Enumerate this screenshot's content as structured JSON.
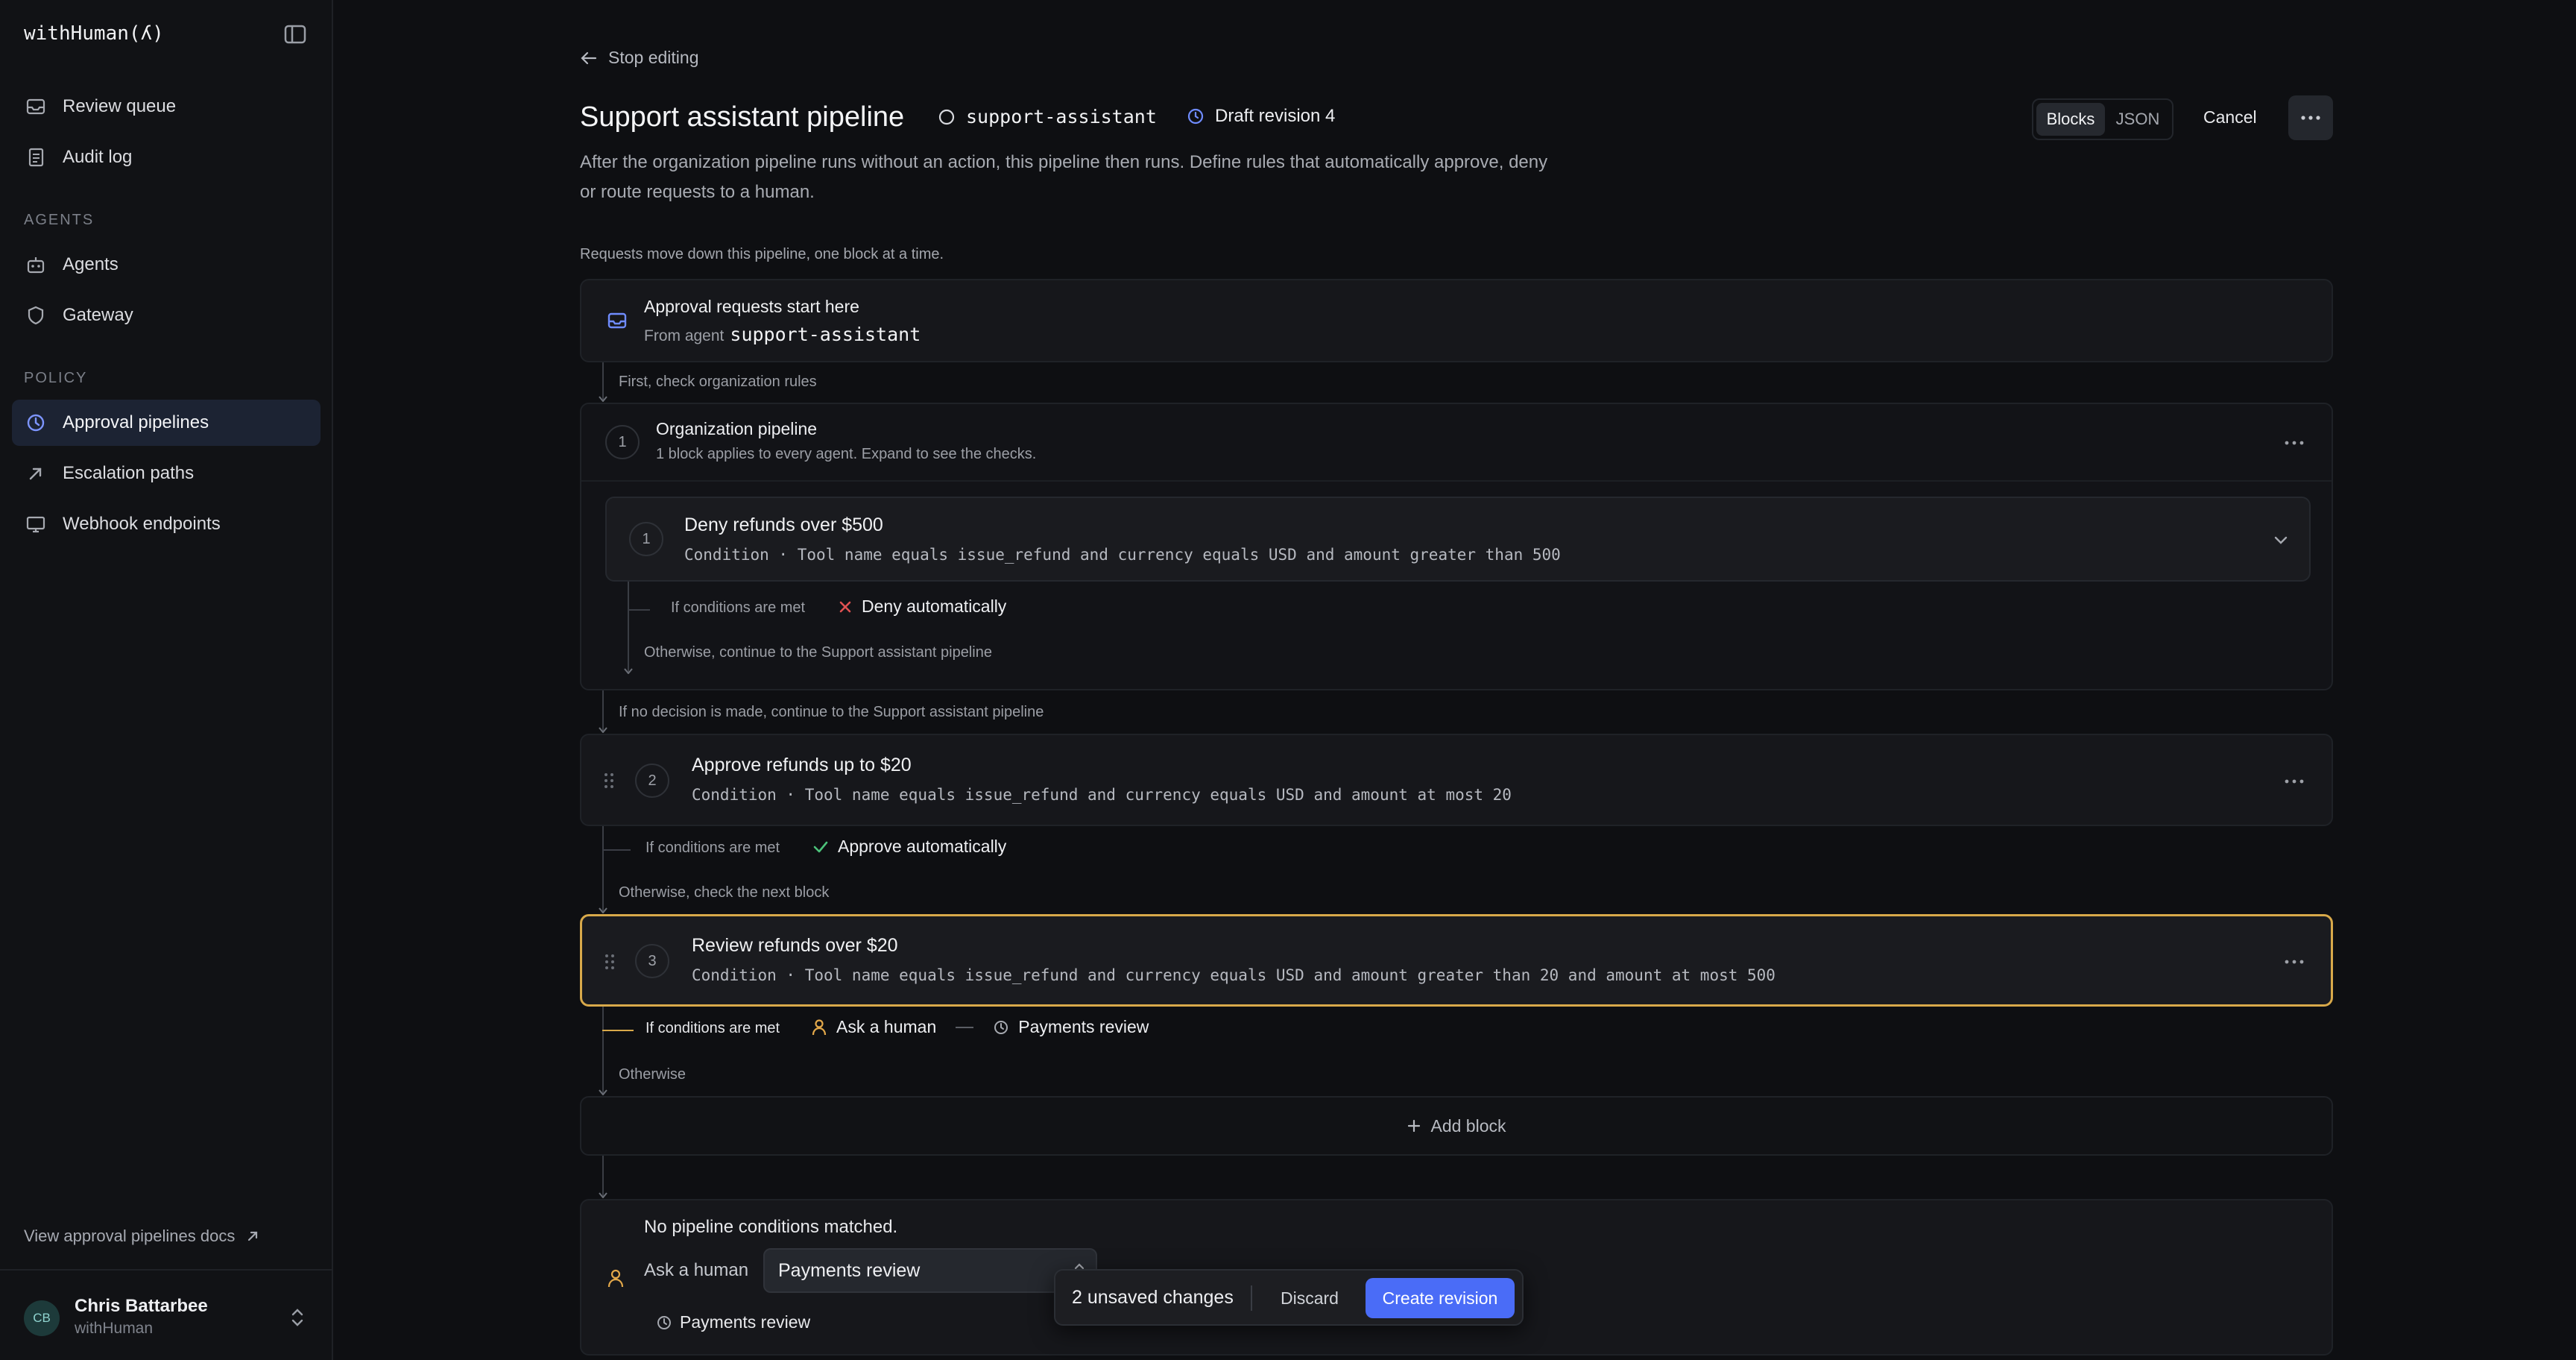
{
  "app": {
    "brand": "withHuman(ʎ)"
  },
  "sidebar": {
    "items_top": [
      {
        "label": "Review queue",
        "icon": "inbox-icon"
      },
      {
        "label": "Audit log",
        "icon": "document-icon"
      }
    ],
    "section_agents": "AGENTS",
    "items_agents": [
      {
        "label": "Agents",
        "icon": "robot-icon"
      },
      {
        "label": "Gateway",
        "icon": "shield-icon"
      }
    ],
    "section_policy": "POLICY",
    "items_policy": [
      {
        "label": "Approval pipelines",
        "icon": "pipeline-icon",
        "active": true
      },
      {
        "label": "Escalation paths",
        "icon": "arrow-up-right-icon"
      },
      {
        "label": "Webhook endpoints",
        "icon": "monitor-icon"
      }
    ],
    "docs_link": "View approval pipelines docs",
    "user": {
      "initials": "CB",
      "name": "Chris Battarbee",
      "org": "withHuman"
    }
  },
  "header": {
    "back_label": "Stop editing",
    "title": "Support assistant pipeline",
    "agent": "support-assistant",
    "draft": "Draft revision 4",
    "view_toggle": {
      "blocks": "Blocks",
      "json": "JSON",
      "selected": "Blocks"
    },
    "cancel": "Cancel",
    "description": "After the organization pipeline runs without an action, this pipeline then runs. Define rules that automatically approve, deny or route requests to a human."
  },
  "pipeline": {
    "intro": "Requests move down this pipeline, one block at a time.",
    "start": {
      "title": "Approval requests start here",
      "from_label": "From agent",
      "agent": "support-assistant"
    },
    "org_connector": "First, check organization rules",
    "org": {
      "number": "1",
      "title": "Organization pipeline",
      "subtitle": "1 block applies to every agent. Expand to see the checks.",
      "rule": {
        "number": "1",
        "title": "Deny refunds over $500",
        "condition": "Condition · Tool name equals issue_refund and currency equals USD and amount greater than 500",
        "if_label": "If conditions are met",
        "outcome": "Deny automatically",
        "otherwise": "Otherwise, continue to the Support assistant pipeline"
      }
    },
    "after_org_connector": "If no decision is made, continue to the Support assistant pipeline",
    "blocks": [
      {
        "number": "2",
        "title": "Approve refunds up to $20",
        "condition": "Condition · Tool name equals issue_refund and currency equals USD and amount at most 20",
        "if_label": "If conditions are met",
        "outcome": "Approve automatically",
        "otherwise": "Otherwise, check the next block"
      },
      {
        "number": "3",
        "title": "Review refunds over $20",
        "condition": "Condition · Tool name equals issue_refund and currency equals USD and amount greater than 20 and amount at most 500",
        "if_label": "If conditions are met",
        "outcome": "Ask a human",
        "path": "Payments review",
        "otherwise": "Otherwise",
        "selected": true
      }
    ],
    "add_block": "Add block",
    "fallback": {
      "title": "No pipeline conditions matched.",
      "ask_label": "Ask a human",
      "selected_path": "Payments review",
      "path_label": "Payments review"
    }
  },
  "toast": {
    "count": "2 unsaved changes",
    "discard": "Discard",
    "create": "Create revision"
  },
  "colors": {
    "accent": "#4a6cf7",
    "selected_border": "#d8a94a",
    "deny": "#e05252",
    "approve": "#4cc27a",
    "human": "#e3a84a",
    "draft": "#6f8cff"
  }
}
